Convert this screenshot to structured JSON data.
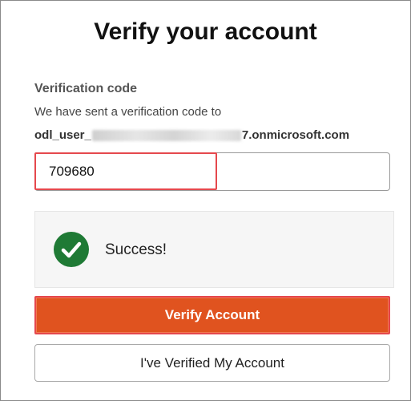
{
  "header": {
    "title": "Verify your account"
  },
  "verification": {
    "label": "Verification code",
    "helper": "We have sent a verification code to",
    "email_prefix": "odl_user_",
    "email_suffix": "7.onmicrosoft.com",
    "code_value": "709680"
  },
  "status": {
    "icon": "check-circle-icon",
    "text": "Success!",
    "color": "#1f7a35"
  },
  "actions": {
    "verify_label": "Verify Account",
    "verify_color": "#e0531f",
    "verified_label": "I've Verified My Account"
  }
}
